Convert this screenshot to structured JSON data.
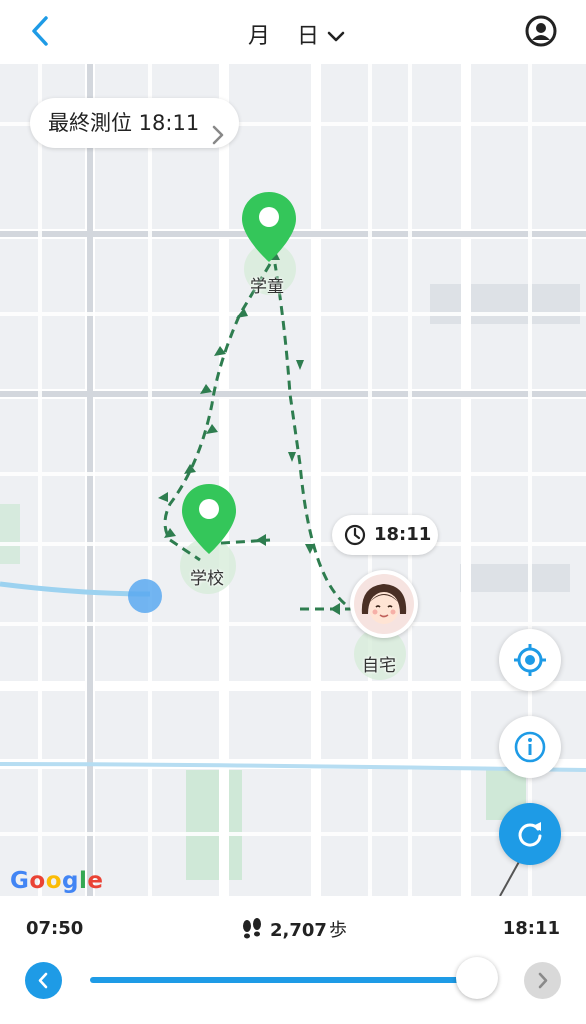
{
  "header": {
    "month_label": "月",
    "day_label": "日",
    "back_icon": "chevron-left-icon",
    "profile_icon": "user-circle-icon",
    "dropdown_icon": "chevron-down-icon"
  },
  "map": {
    "last_location_label": "最終測位 18:11",
    "places": [
      {
        "label": "学童"
      },
      {
        "label": "学校"
      },
      {
        "label": "自宅"
      }
    ],
    "time_bubble": "18:11",
    "route_color": "#2e7d4f",
    "pin_color": "#34c65a",
    "google_logo": "Google"
  },
  "fabs": {
    "locate_icon": "crosshair-icon",
    "info_icon": "info-icon",
    "refresh_icon": "refresh-icon"
  },
  "timeline": {
    "start_time": "07:50",
    "end_time": "18:11",
    "steps": "2,707",
    "steps_unit": "歩",
    "progress": 1.0,
    "accent_color": "#1e9be6"
  }
}
